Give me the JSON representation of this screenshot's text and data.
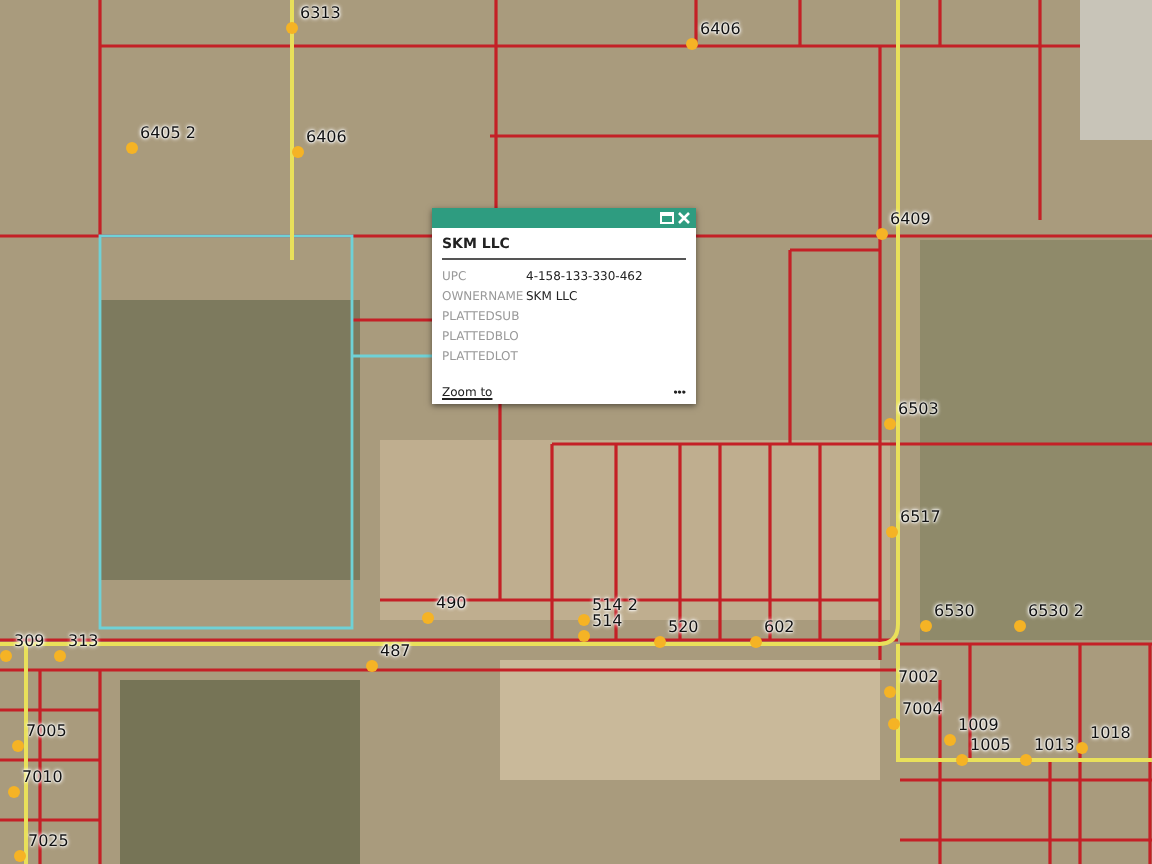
{
  "map": {
    "address_labels": [
      {
        "text": "6313"
      },
      {
        "text": "6406"
      },
      {
        "text": "6405 2"
      },
      {
        "text": "6406"
      },
      {
        "text": "6409"
      },
      {
        "text": "6503"
      },
      {
        "text": "6517"
      },
      {
        "text": "490"
      },
      {
        "text": "514 2"
      },
      {
        "text": "6530"
      },
      {
        "text": "6530 2"
      },
      {
        "text": "309"
      },
      {
        "text": "313"
      },
      {
        "text": "514"
      },
      {
        "text": "520"
      },
      {
        "text": "602"
      },
      {
        "text": "487"
      },
      {
        "text": "7002"
      },
      {
        "text": "7004"
      },
      {
        "text": "7005"
      },
      {
        "text": "1009"
      },
      {
        "text": "1018"
      },
      {
        "text": "1005"
      },
      {
        "text": "1013"
      },
      {
        "text": "7010"
      },
      {
        "text": "7025"
      }
    ]
  },
  "popup": {
    "title": "SKM LLC",
    "fields": [
      {
        "label": "UPC",
        "value": "4-158-133-330-462"
      },
      {
        "label": "OWNERNAME",
        "value": "SKM LLC"
      },
      {
        "label": "PLATTEDSUB"
      },
      {
        "label": "PLATTEDBLO"
      },
      {
        "label": "PLATTEDLOT"
      }
    ],
    "link": "Zoom to",
    "menu": "•••"
  }
}
